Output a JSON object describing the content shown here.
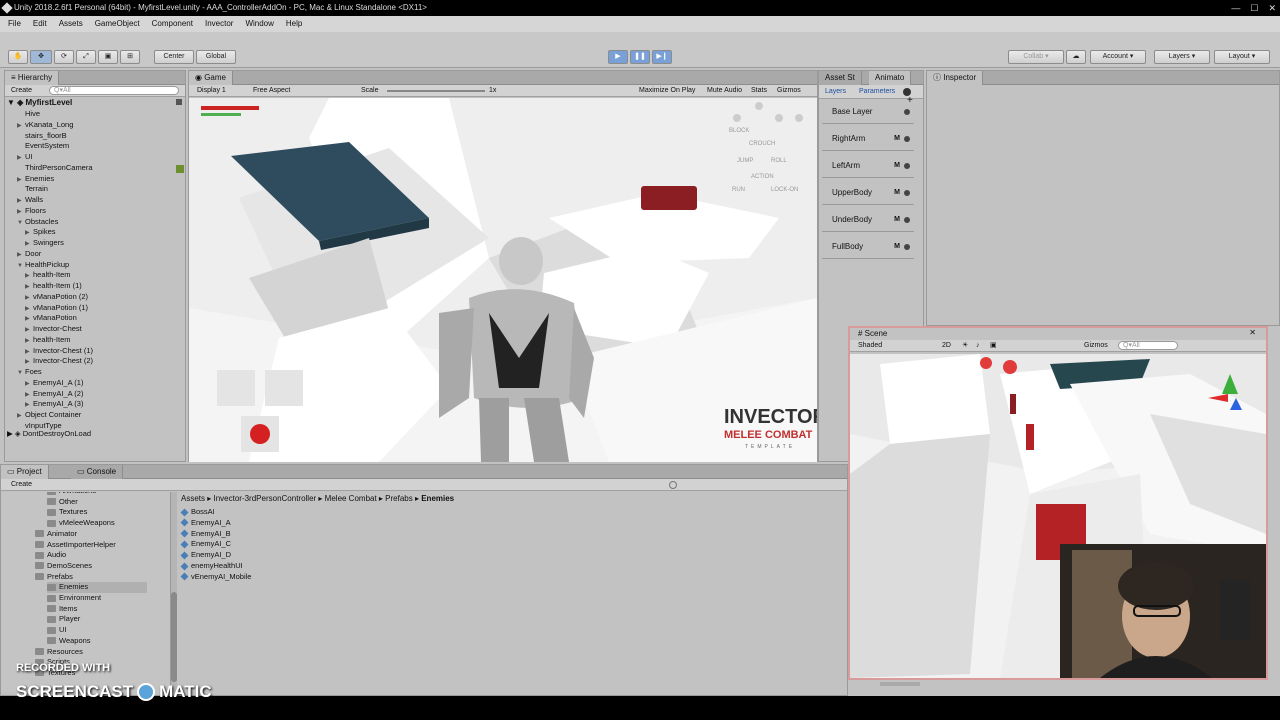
{
  "window": {
    "title": "Unity 2018.2.6f1 Personal (64bit) - MyfirstLevel.unity - AAA_ControllerAddOn - PC, Mac & Linux Standalone <DX11>"
  },
  "menu": [
    "File",
    "Edit",
    "Assets",
    "GameObject",
    "Component",
    "Invector",
    "Window",
    "Help"
  ],
  "toolbar": {
    "center": "Center",
    "global": "Global",
    "collab": "Collab",
    "account": "Account",
    "layers": "Layers",
    "layout": "Layout"
  },
  "hierarchy": {
    "tab": "Hierarchy",
    "create": "Create",
    "search": "Q▾All",
    "scene": "MyfirstLevel",
    "items": [
      {
        "label": "Hive",
        "indent": 1,
        "arrow": ""
      },
      {
        "label": "vKanata_Long",
        "indent": 1,
        "arrow": "▶"
      },
      {
        "label": "stairs_floorB",
        "indent": 1,
        "arrow": ""
      },
      {
        "label": "EventSystem",
        "indent": 1,
        "arrow": ""
      },
      {
        "label": "UI",
        "indent": 1,
        "arrow": "▶"
      },
      {
        "label": "ThirdPersonCamera",
        "indent": 1,
        "arrow": ""
      },
      {
        "label": "Enemies",
        "indent": 1,
        "arrow": "▶"
      },
      {
        "label": "Terrain",
        "indent": 1,
        "arrow": ""
      },
      {
        "label": "Walls",
        "indent": 1,
        "arrow": "▶"
      },
      {
        "label": "Floors",
        "indent": 1,
        "arrow": "▶"
      },
      {
        "label": "Obstacles",
        "indent": 1,
        "arrow": "▼"
      },
      {
        "label": "Spikes",
        "indent": 2,
        "arrow": "▶"
      },
      {
        "label": "Swingers",
        "indent": 2,
        "arrow": "▶"
      },
      {
        "label": "Door",
        "indent": 1,
        "arrow": "▶"
      },
      {
        "label": "HealthPickup",
        "indent": 1,
        "arrow": "▼"
      },
      {
        "label": "health-Item",
        "indent": 2,
        "arrow": "▶"
      },
      {
        "label": "health-Item (1)",
        "indent": 2,
        "arrow": "▶"
      },
      {
        "label": "vManaPotion (2)",
        "indent": 2,
        "arrow": "▶"
      },
      {
        "label": "vManaPotion (1)",
        "indent": 2,
        "arrow": "▶"
      },
      {
        "label": "vManaPotion",
        "indent": 2,
        "arrow": "▶"
      },
      {
        "label": "Invector-Chest",
        "indent": 2,
        "arrow": "▶"
      },
      {
        "label": "health-Item",
        "indent": 2,
        "arrow": "▶"
      },
      {
        "label": "Invector-Chest (1)",
        "indent": 2,
        "arrow": "▶"
      },
      {
        "label": "Invector-Chest (2)",
        "indent": 2,
        "arrow": "▶"
      },
      {
        "label": "Foes",
        "indent": 1,
        "arrow": "▼"
      },
      {
        "label": "EnemyAI_A (1)",
        "indent": 2,
        "arrow": "▶"
      },
      {
        "label": "EnemyAI_A (2)",
        "indent": 2,
        "arrow": "▶"
      },
      {
        "label": "EnemyAI_A (3)",
        "indent": 2,
        "arrow": "▶"
      },
      {
        "label": "Object Container",
        "indent": 1,
        "arrow": "▶"
      },
      {
        "label": "vInputType",
        "indent": 1,
        "arrow": ""
      }
    ],
    "dontdestroy": "DontDestroyOnLoad"
  },
  "game": {
    "tab": "Game",
    "display": "Display 1",
    "aspect": "Free Aspect",
    "scale": "Scale",
    "scale_val": "1x",
    "maximize": "Maximize On Play",
    "mute": "Mute Audio",
    "stats": "Stats",
    "gizmos": "Gizmos",
    "hud_controls": [
      "BLOCK",
      "CROUCH",
      "JUMP",
      "ROLL",
      "ACTION",
      "RUN",
      "LOCK-ON"
    ],
    "logo1": "INVECTOR",
    "logo2": "MELEE COMBAT",
    "logo3": "TEMPLATE"
  },
  "animator": {
    "tab1": "Asset St",
    "tab2": "Animato",
    "sub1": "Layers",
    "sub2": "Parameters",
    "layers": [
      "Base Layer",
      "RightArm",
      "LeftArm",
      "UpperBody",
      "UnderBody",
      "FullBody"
    ],
    "m": "M"
  },
  "inspector": {
    "tab": "Inspector"
  },
  "project": {
    "tab": "Project",
    "console": "Console",
    "create": "Create",
    "folders": [
      {
        "label": "Animations",
        "indent": 3
      },
      {
        "label": "Other",
        "indent": 3
      },
      {
        "label": "Textures",
        "indent": 3
      },
      {
        "label": "vMeleeWeapons",
        "indent": 3
      },
      {
        "label": "Animator",
        "indent": 2
      },
      {
        "label": "AssetImporterHelper",
        "indent": 2
      },
      {
        "label": "Audio",
        "indent": 2
      },
      {
        "label": "DemoScenes",
        "indent": 2
      },
      {
        "label": "Prefabs",
        "indent": 2
      },
      {
        "label": "Enemies",
        "indent": 3
      },
      {
        "label": "Environment",
        "indent": 3
      },
      {
        "label": "Items",
        "indent": 3
      },
      {
        "label": "Player",
        "indent": 3
      },
      {
        "label": "UI",
        "indent": 3
      },
      {
        "label": "Weapons",
        "indent": 3
      },
      {
        "label": "Resources",
        "indent": 2
      },
      {
        "label": "Scripts",
        "indent": 2
      },
      {
        "label": "Textures",
        "indent": 2
      }
    ],
    "breadcrumb": [
      "Assets",
      "Invector-3rdPersonController",
      "Melee Combat",
      "Prefabs",
      "Enemies"
    ],
    "assets": [
      "BossAI",
      "EnemyAI_A",
      "EnemyAI_B",
      "EnemyAI_C",
      "EnemyAI_D",
      "enemyHealthUI",
      "vEnemyAI_Mobile"
    ]
  },
  "scene": {
    "tab": "Scene",
    "shaded": "Shaded",
    "mode2d": "2D",
    "gizmos": "Gizmos",
    "search": "Q▾All"
  },
  "watermark": {
    "line1": "RECORDED WITH",
    "line2a": "SCREENCAST",
    "line2b": "MATIC"
  }
}
